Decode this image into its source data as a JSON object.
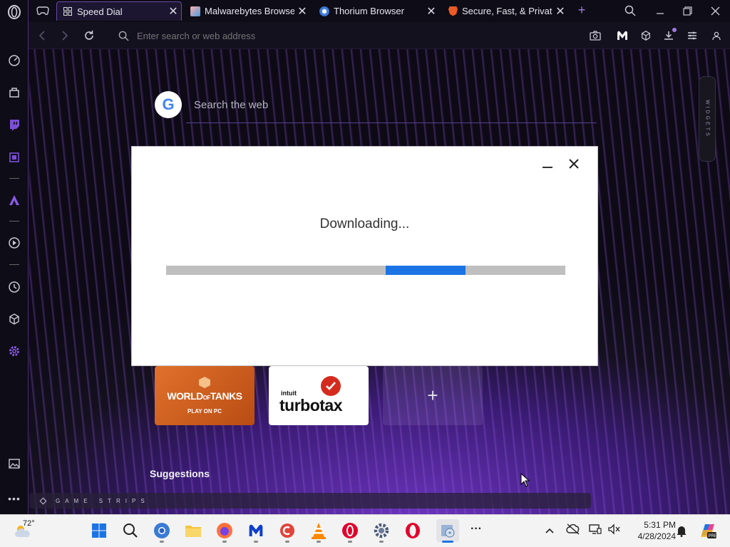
{
  "tabs": [
    {
      "label": "Speed Dial",
      "active": true
    },
    {
      "label": "Malwarebytes Browser G"
    },
    {
      "label": "Thorium Browser"
    },
    {
      "label": "Secure, Fast, & Private W"
    }
  ],
  "tab_close": "✕",
  "new_tab": "+",
  "address": {
    "placeholder": "Enter search or web address"
  },
  "search": {
    "placeholder": "Search the web",
    "engine_letter": "G"
  },
  "widgets_label": "WIDGETS",
  "speed_dial": {
    "world_of_tanks": {
      "line1": "WORLD",
      "line2": "TANKS",
      "of": "OF",
      "tagline": "PLAY ON PC"
    },
    "turbotax": {
      "brand": "intuit",
      "name": "turbotax"
    },
    "add_label": "+"
  },
  "suggestions_label": "Suggestions",
  "game_strips_label": "GAME STRIPS",
  "dialog": {
    "title": "Downloading...",
    "progress_start": 0.55,
    "progress_end": 0.75
  },
  "taskbar": {
    "weather_temp": "72°",
    "time": "5:31 PM",
    "date": "4/28/2024",
    "more_label": "···",
    "chevron": "^"
  },
  "colors": {
    "accent": "#7b4fd6",
    "progress": "#1b74e4",
    "opera_red": "#e3002b"
  }
}
